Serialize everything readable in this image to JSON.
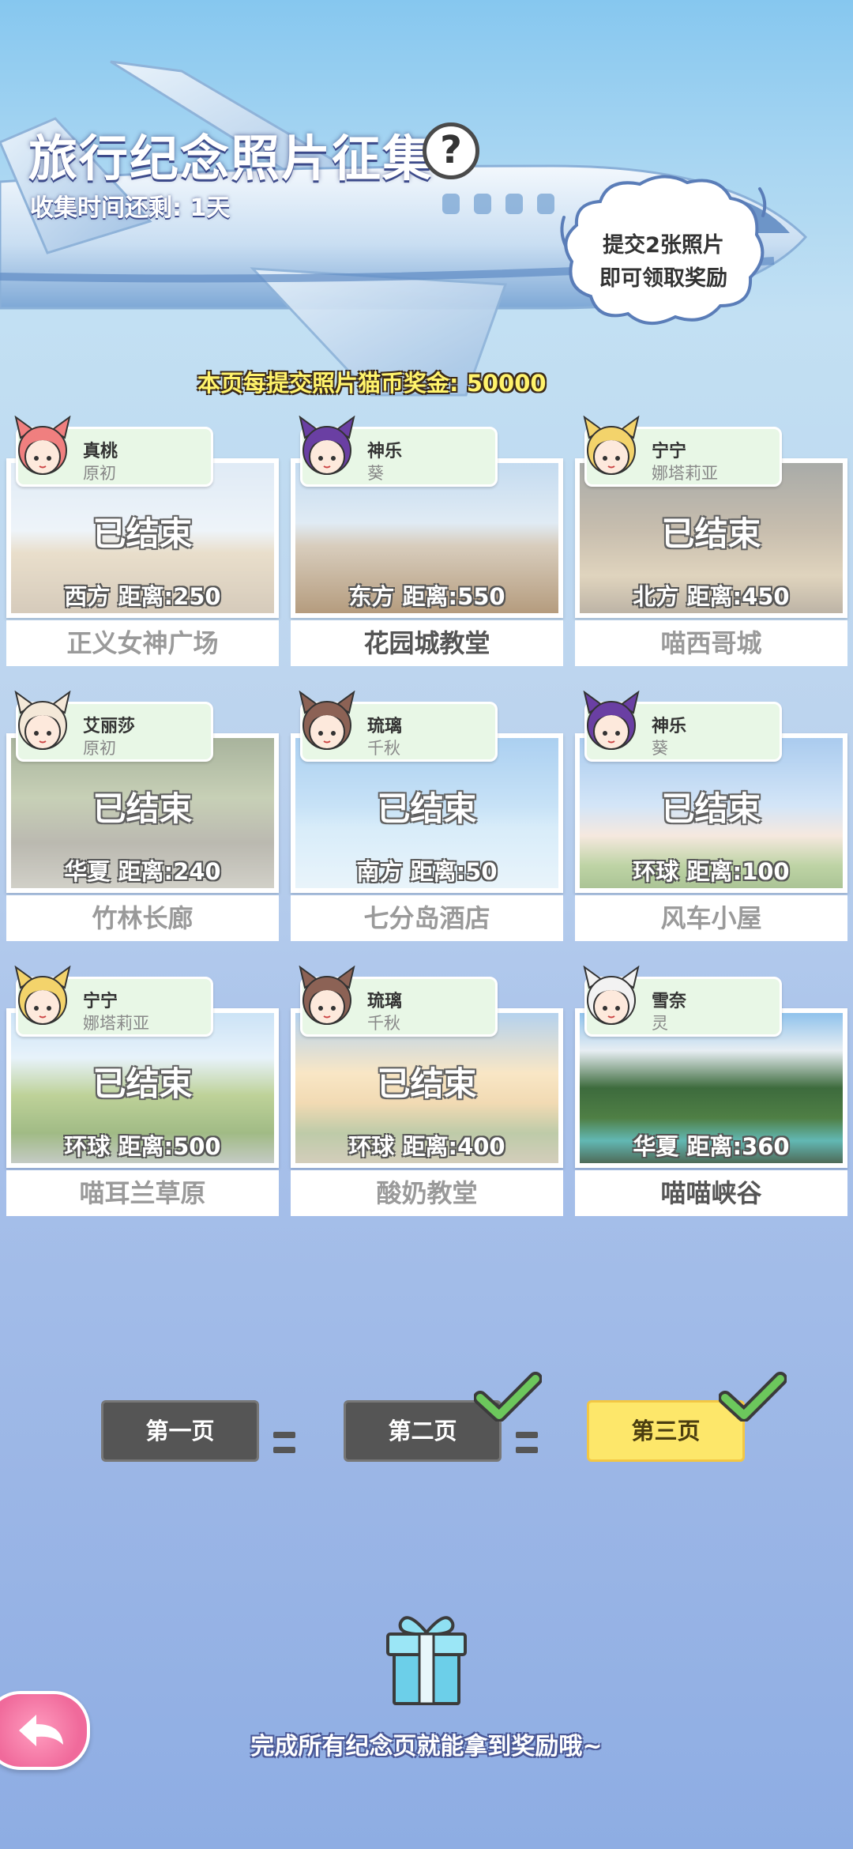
{
  "header": {
    "title": "旅行纪念照片征集",
    "help_icon": "question-mark-icon",
    "help_symbol": "?",
    "timer": "收集时间还剩: 1天",
    "bubble_line1": "提交2张照片",
    "bubble_line2": "即可领取奖励",
    "bonus": "本页每提交照片猫币奖金: 50000"
  },
  "cards": [
    {
      "char_name": "真桃",
      "char_sub": "原初",
      "status": "已结束",
      "distance": "西方  距离:250",
      "place": "正义女神广场"
    },
    {
      "char_name": "神乐",
      "char_sub": "葵",
      "status": "",
      "distance": "东方  距离:550",
      "place": "花园城教堂"
    },
    {
      "char_name": "宁宁",
      "char_sub": "娜塔莉亚",
      "status": "已结束",
      "distance": "北方  距离:450",
      "place": "喵西哥城"
    },
    {
      "char_name": "艾丽莎",
      "char_sub": "原初",
      "status": "已结束",
      "distance": "华夏  距离:240",
      "place": "竹林长廊"
    },
    {
      "char_name": "琉璃",
      "char_sub": "千秋",
      "status": "已结束",
      "distance": "南方  距离:50",
      "place": "七分岛酒店"
    },
    {
      "char_name": "神乐",
      "char_sub": "葵",
      "status": "已结束",
      "distance": "环球  距离:100",
      "place": "风车小屋"
    },
    {
      "char_name": "宁宁",
      "char_sub": "娜塔莉亚",
      "status": "已结束",
      "distance": "环球  距离:500",
      "place": "喵耳兰草原"
    },
    {
      "char_name": "琉璃",
      "char_sub": "千秋",
      "status": "已结束",
      "distance": "环球  距离:400",
      "place": "酸奶教堂"
    },
    {
      "char_name": "雪奈",
      "char_sub": "灵",
      "status": "",
      "distance": "华夏  距离:360",
      "place": "喵喵峡谷"
    }
  ],
  "pages": {
    "p1": "第一页",
    "p2": "第二页",
    "p3": "第三页"
  },
  "footer": {
    "gift_icon": "gift-box-icon",
    "text": "完成所有纪念页就能拿到奖励哦~",
    "back_icon": "back-arrow-icon"
  },
  "colors": {
    "active_page": "#fde76a",
    "inactive_page": "#555555",
    "check": "#66c25a",
    "tag_bg": "#e8f7e6"
  }
}
